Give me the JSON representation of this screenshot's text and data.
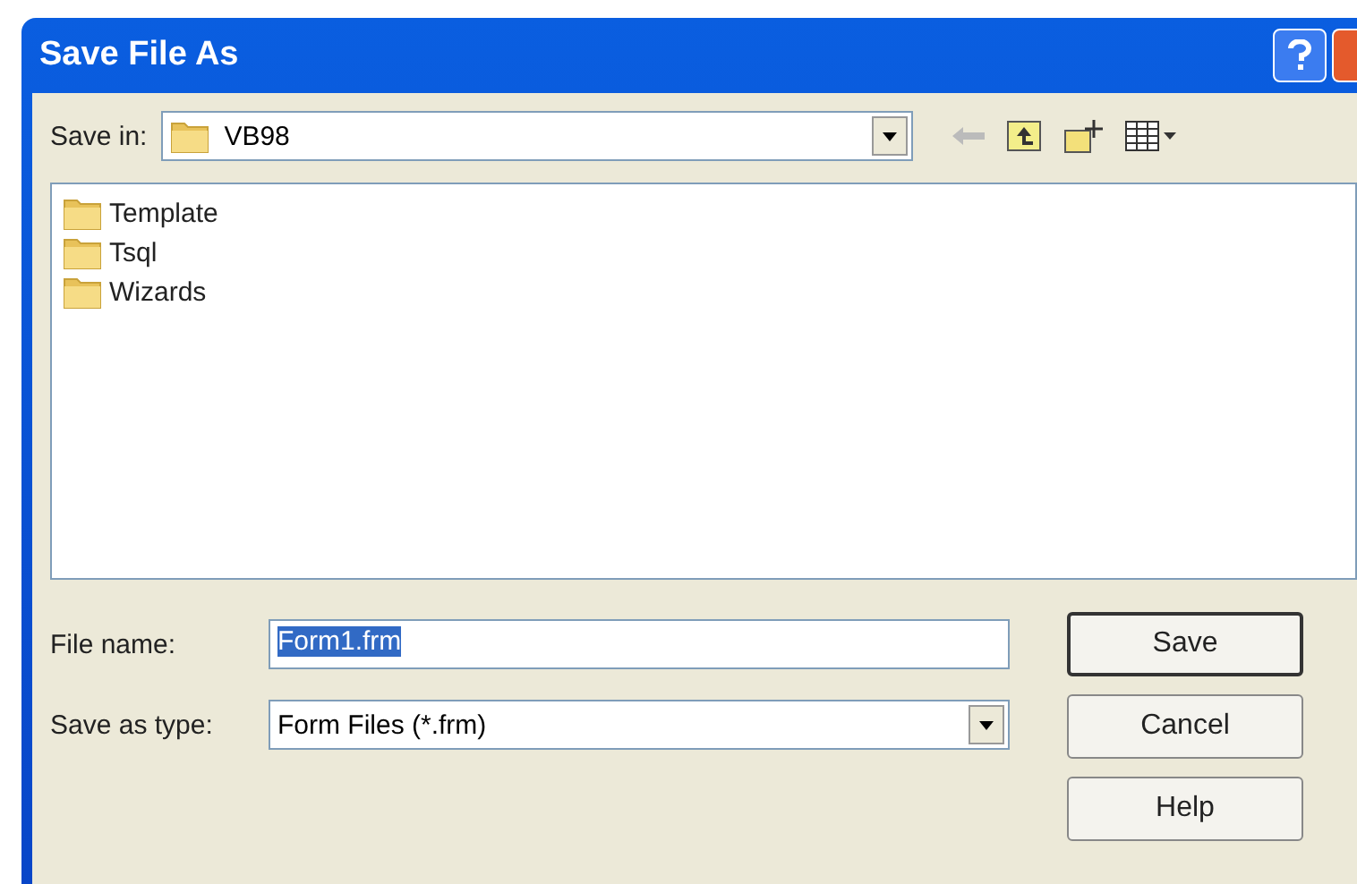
{
  "window": {
    "title": "Save File As"
  },
  "save_in": {
    "label": "Save in:",
    "value": "VB98"
  },
  "files": [
    {
      "name": "Template",
      "selected": false
    },
    {
      "name": "Tsql",
      "selected": false
    },
    {
      "name": "Wizards",
      "selected": false
    }
  ],
  "file_name": {
    "label": "File name:",
    "value": "Form1.frm"
  },
  "save_as_type": {
    "label": "Save as type:",
    "value": "Form Files (*.frm)"
  },
  "buttons": [
    {
      "label": "Save",
      "kind": "default"
    },
    {
      "label": "Cancel",
      "kind": "normal"
    },
    {
      "label": "Help",
      "kind": "normal"
    }
  ]
}
